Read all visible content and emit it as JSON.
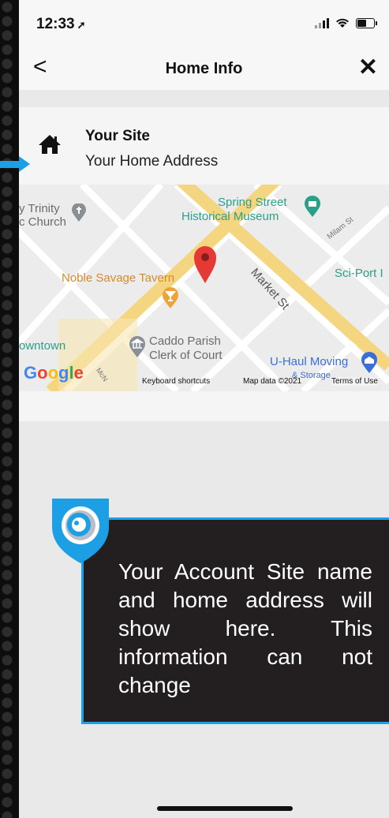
{
  "status_bar": {
    "time": "12:33",
    "location_arrow": "➚"
  },
  "nav": {
    "back_label": "<",
    "title": "Home Info",
    "close_label": "✕"
  },
  "site": {
    "name": "Your Site",
    "address": "Your Home Address",
    "icon": "home-icon"
  },
  "map": {
    "labels": {
      "trinity": "y Trinity\nc Church",
      "spring_street": "Spring Street",
      "historical_museum": "Historical Museum",
      "noble_savage": "Noble Savage Tavern",
      "market_st": "Market St",
      "milam_st": "Milam St",
      "sci_port": "Sci-Port I",
      "downtown": "owntown",
      "caddo_parish": "Caddo Parish",
      "clerk_of_court": "Clerk of Court",
      "uhaul": "U-Haul Moving",
      "mc_neil": "McN",
      "storage": "& Storage"
    },
    "google_logo": "Google",
    "footer": {
      "keyboard_shortcuts": "Keyboard shortcuts",
      "map_data": "Map data ©2021",
      "terms": "Terms of Use"
    },
    "colors": {
      "road_major": "#f5d680",
      "road_minor": "#ffffff",
      "land": "#ececec",
      "pin": "#e53935"
    }
  },
  "callout": {
    "text": "Your Account Site name and home address will show here. This information can not change",
    "border_color": "#1d9fe6",
    "background": "#231f20"
  }
}
